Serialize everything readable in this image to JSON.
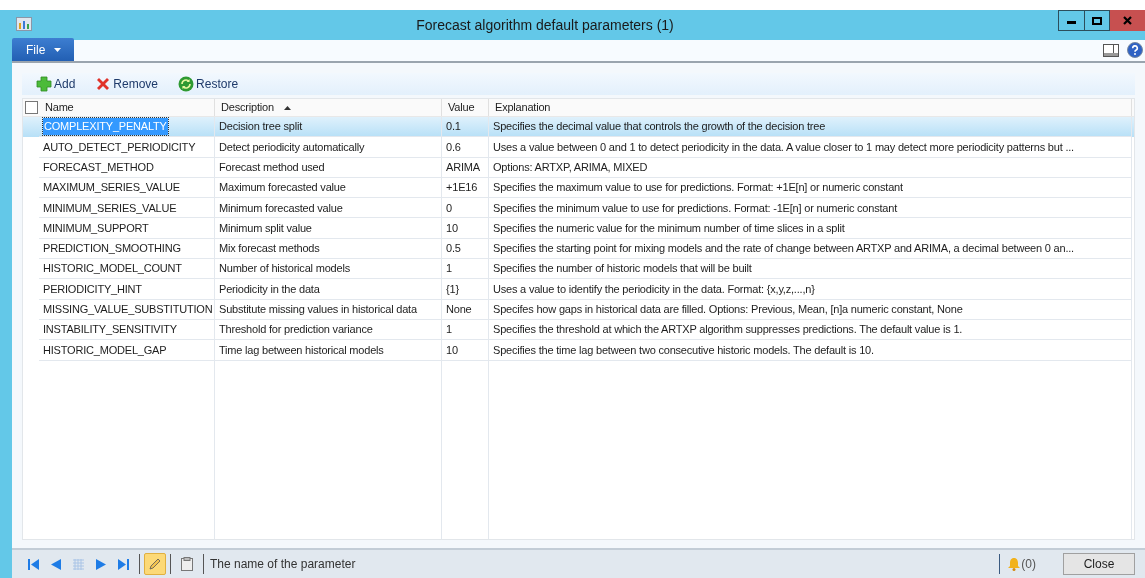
{
  "window": {
    "title": "Forecast algorithm default parameters (1)"
  },
  "menu": {
    "file": "File"
  },
  "toolbar": [
    {
      "kind": "add",
      "label": "Add"
    },
    {
      "kind": "remove",
      "label": "Remove"
    },
    {
      "kind": "restore",
      "label": "Restore"
    }
  ],
  "table": {
    "all_checked": false,
    "columns": [
      {
        "label": "Name",
        "sorted": false
      },
      {
        "label": "Description",
        "sorted": true
      },
      {
        "label": "Value",
        "sorted": false
      },
      {
        "label": "Explanation",
        "sorted": false
      }
    ],
    "rows": [
      {
        "selected": true,
        "cells": [
          "COMPLEXITY_PENALTY",
          "Decision tree split",
          "0.1",
          "Specifies the decimal value that controls the growth of the decision tree"
        ]
      },
      {
        "selected": false,
        "cells": [
          "AUTO_DETECT_PERIODICITY",
          "Detect periodicity automatically",
          "0.6",
          "Uses a value between 0 and 1 to detect periodicity in the data. A value closer to 1 may detect more periodicity patterns but ..."
        ]
      },
      {
        "selected": false,
        "cells": [
          "FORECAST_METHOD",
          "Forecast method used",
          "ARIMA",
          "Options: ARTXP, ARIMA, MIXED"
        ]
      },
      {
        "selected": false,
        "cells": [
          "MAXIMUM_SERIES_VALUE",
          "Maximum forecasted value",
          "+1E16",
          "Specifies the maximum value to use for predictions. Format: +1E[n] or numeric constant"
        ]
      },
      {
        "selected": false,
        "cells": [
          "MINIMUM_SERIES_VALUE",
          "Minimum forecasted value",
          "0",
          "Specifies the minimum value to use for predictions. Format: -1E[n] or numeric constant"
        ]
      },
      {
        "selected": false,
        "cells": [
          "MINIMUM_SUPPORT",
          "Minimum split value",
          "10",
          "Specifies the numeric value for the minimum number of time slices in a split"
        ]
      },
      {
        "selected": false,
        "cells": [
          "PREDICTION_SMOOTHING",
          "Mix forecast methods",
          "0.5",
          "Specifies the starting point for mixing models and the rate of change between ARTXP and ARIMA, a decimal between 0 an..."
        ]
      },
      {
        "selected": false,
        "cells": [
          "HISTORIC_MODEL_COUNT",
          "Number of historical models",
          "1",
          "Specifies the number of historic models that will be built"
        ]
      },
      {
        "selected": false,
        "cells": [
          "PERIODICITY_HINT",
          "Periodicity in the data",
          "{1}",
          "Uses a value to identify the periodicity in the data. Format: {x,y,z,...,n}"
        ]
      },
      {
        "selected": false,
        "cells": [
          "MISSING_VALUE_SUBSTITUTION",
          "Substitute missing values in historical data",
          "None",
          "Specifes how gaps in historical data are filled. Options:  Previous, Mean, [n]a numeric constant, None"
        ]
      },
      {
        "selected": false,
        "cells": [
          "INSTABILITY_SENSITIVITY",
          "Threshold for prediction variance",
          "1",
          "Specifies the threshold at which the ARTXP algorithm suppresses predictions. The default value is 1."
        ]
      },
      {
        "selected": false,
        "cells": [
          "HISTORIC_MODEL_GAP",
          "Time lag between historical models",
          "10",
          "Specifies the time lag between two consecutive historic models. The default is 10."
        ]
      }
    ]
  },
  "status_bar": {
    "edit_mode": true,
    "help_text": "The name of the parameter",
    "notifications": "(0)",
    "close": "Close"
  }
}
